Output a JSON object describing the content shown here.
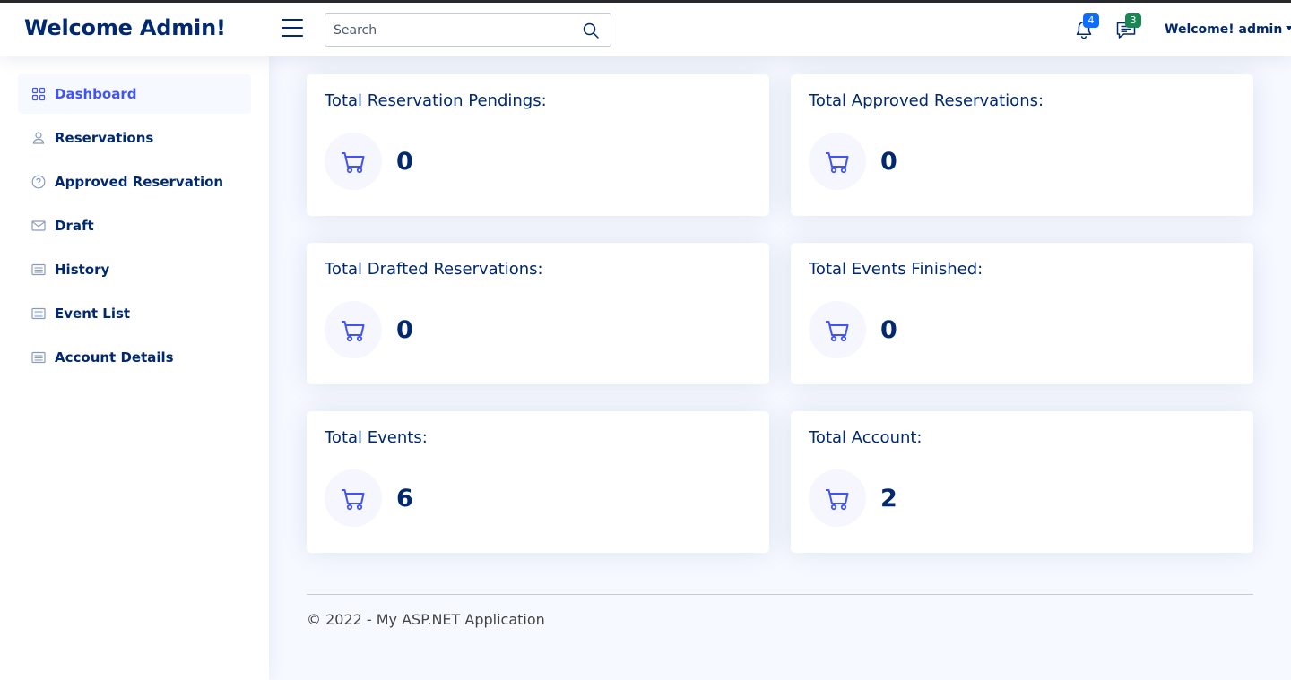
{
  "header": {
    "brand": "Welcome Admin!",
    "menu_icon": "hamburger-menu-icon",
    "search": {
      "placeholder": "Search",
      "value": "",
      "icon": "search-icon"
    },
    "notifications": {
      "icon": "bell-icon",
      "count": "4",
      "badge_color": "#0d6efd"
    },
    "messages": {
      "icon": "chat-icon",
      "count": "3",
      "badge_color": "#198754"
    },
    "user_menu": {
      "label": "Welcome! admin"
    }
  },
  "sidebar": {
    "items": [
      {
        "label": "Dashboard",
        "icon": "grid-icon",
        "active": true
      },
      {
        "label": "Reservations",
        "icon": "person-icon"
      },
      {
        "label": "Approved Reservation",
        "icon": "question-circle-icon"
      },
      {
        "label": "Draft",
        "icon": "envelope-icon"
      },
      {
        "label": "History",
        "icon": "list-icon"
      },
      {
        "label": "Event List",
        "icon": "list-icon"
      },
      {
        "label": "Account Details",
        "icon": "list-icon"
      }
    ]
  },
  "cards": [
    {
      "title": "Total Reservation Pendings:",
      "value": "0",
      "icon": "cart-icon"
    },
    {
      "title": "Total Approved Reservations:",
      "value": "0",
      "icon": "cart-icon"
    },
    {
      "title": "Total Drafted Reservations:",
      "value": "0",
      "icon": "cart-icon"
    },
    {
      "title": "Total Events Finished:",
      "value": "0",
      "icon": "cart-icon"
    },
    {
      "title": "Total Events:",
      "value": "6",
      "icon": "cart-icon"
    },
    {
      "title": "Total Account:",
      "value": "2",
      "icon": "cart-icon"
    }
  ],
  "footer": {
    "text": "© 2022 - My ASP.NET Application"
  },
  "colors": {
    "primary_text": "#012970",
    "accent": "#4154f1",
    "page_background": "#f6f9ff",
    "card_background": "#ffffff"
  }
}
